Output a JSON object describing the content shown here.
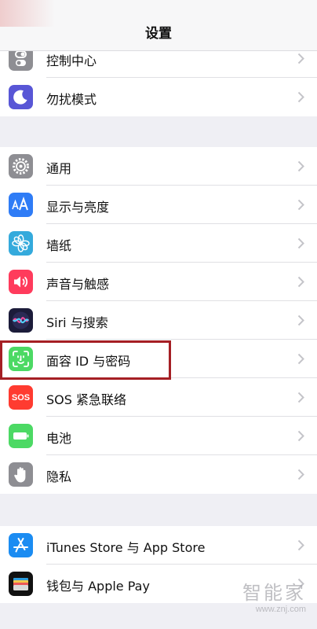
{
  "navbar": {
    "title": "设置"
  },
  "watermark": {
    "main": "智能家",
    "url": "www.znj.com"
  },
  "colors": {
    "highlight_box": "#a51f24",
    "group_background": "#ffffff",
    "page_background": "#efeff4"
  },
  "groups": [
    {
      "items": [
        {
          "label": "控制中心",
          "icon": "control-center-icon",
          "icon_color": "#8e8e93"
        },
        {
          "label": "勿扰模式",
          "icon": "moon-icon",
          "icon_color": "#5856d6"
        }
      ]
    },
    {
      "items": [
        {
          "label": "通用",
          "icon": "gear-icon",
          "icon_color": "#8e8e93"
        },
        {
          "label": "显示与亮度",
          "icon": "display-brightness-icon",
          "icon_color": "#2f7cf6"
        },
        {
          "label": "墙纸",
          "icon": "wallpaper-flower-icon",
          "icon_color": "#34aadc"
        },
        {
          "label": "声音与触感",
          "icon": "speaker-icon",
          "icon_color": "#ff3b5c"
        },
        {
          "label": "Siri 与搜索",
          "icon": "siri-icon",
          "icon_color": "#1c1c3a"
        },
        {
          "label": "面容 ID 与密码",
          "icon": "face-id-icon",
          "icon_color": "#4cd964"
        },
        {
          "label": "SOS 紧急联络",
          "icon": "sos-icon",
          "icon_color": "#ff3b30",
          "icon_text": "SOS"
        },
        {
          "label": "电池",
          "icon": "battery-icon",
          "icon_color": "#4cd964"
        },
        {
          "label": "隐私",
          "icon": "hand-icon",
          "icon_color": "#8e8e93"
        }
      ]
    },
    {
      "items": [
        {
          "label": "iTunes Store 与 App Store",
          "icon": "app-store-icon",
          "icon_color": "#1b8cf2"
        },
        {
          "label": "钱包与 Apple Pay",
          "icon": "wallet-icon",
          "icon_color": "#111111"
        }
      ]
    }
  ]
}
